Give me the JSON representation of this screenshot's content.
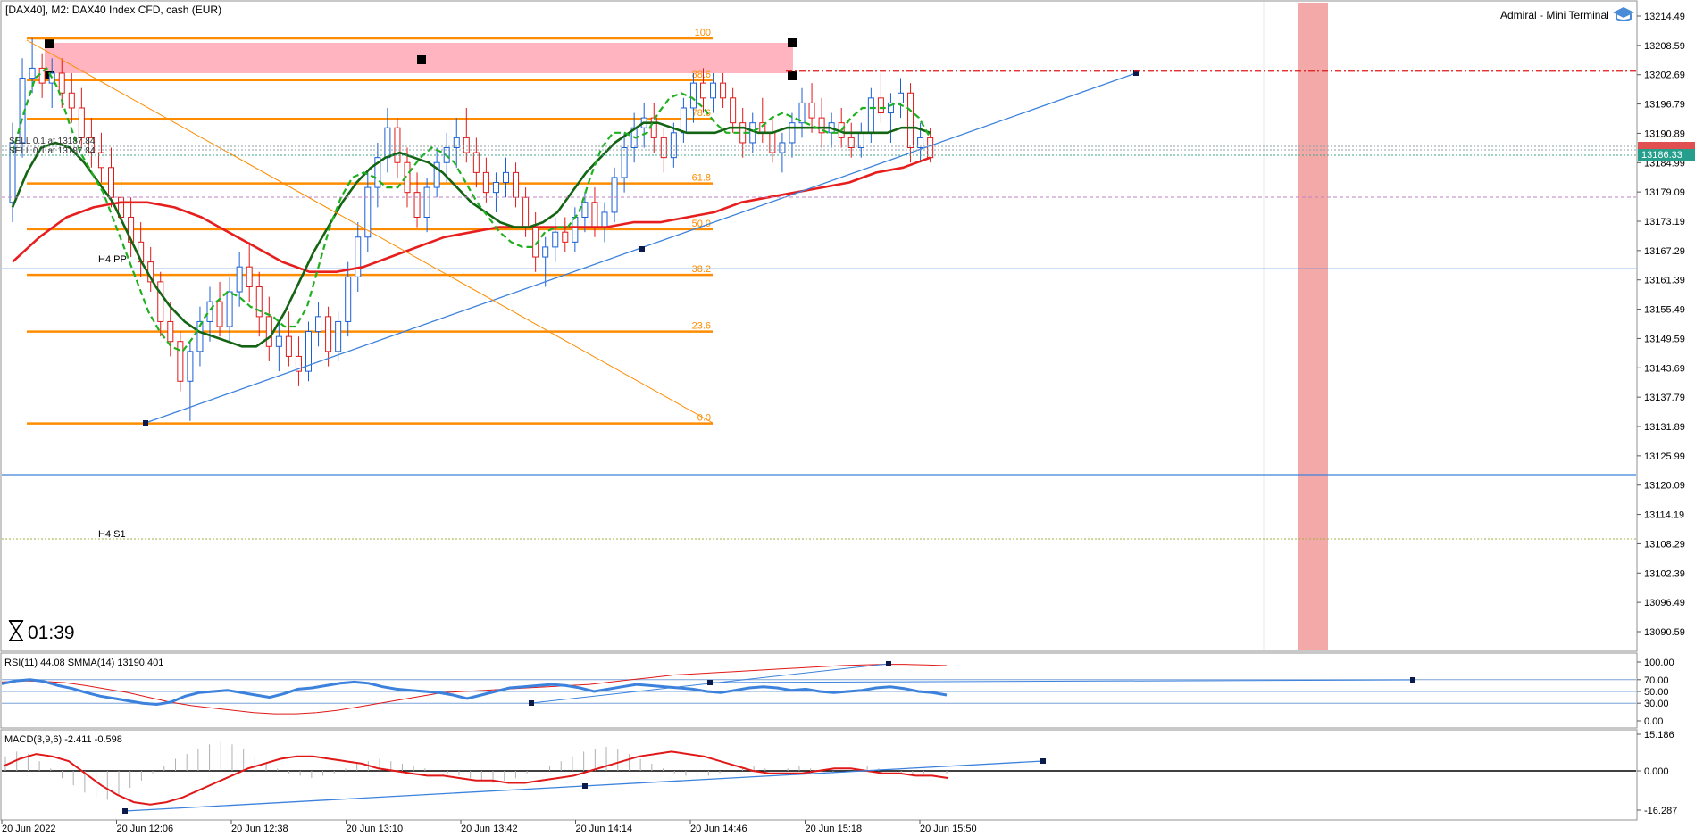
{
  "header": {
    "symbol_title": "[DAX40], M2:  DAX40 Index CFD, cash (EUR)",
    "terminal_label": "Admiral - Mini Terminal"
  },
  "timer": {
    "label": "01:39"
  },
  "colors": {
    "bull": "#1a5fd6",
    "bear": "#e01818",
    "fib": "#ff8c00",
    "trend": "#3c82dc",
    "ma_fast": "#1fb01f",
    "ma_mid": "#136413",
    "ma_slow": "#e61e1e",
    "zone": "#ffb4bf",
    "band": "#f08c8c",
    "price_tag": "#259e8c"
  },
  "order_labels": [
    "SELL 0.1 at 13187.84",
    "SELL 0.1 at 13187.84"
  ],
  "pivot_labels": {
    "pp": "H4 PP",
    "s1": "H4 S1"
  },
  "current_price": "13186.33",
  "chart_data": [
    {
      "type": "candlestick",
      "y_ticks": [
        "13214.49",
        "13208.59",
        "13202.69",
        "13196.79",
        "13190.89",
        "13184.99",
        "13179.09",
        "13173.19",
        "13167.29",
        "13161.39",
        "13155.49",
        "13149.59",
        "13143.69",
        "13137.79",
        "13131.89",
        "13125.99",
        "13120.09",
        "13114.19",
        "13108.29",
        "13102.39",
        "13096.49",
        "13090.59"
      ],
      "ylim": [
        13085.5,
        13216.8
      ],
      "x_ticks": [
        "20 Jun 2022",
        "20 Jun 12:06",
        "20 Jun 12:38",
        "20 Jun 13:10",
        "20 Jun 13:42",
        "20 Jun 14:14",
        "20 Jun 14:46",
        "20 Jun 15:18",
        "20 Jun 15:50"
      ],
      "fib_levels": [
        {
          "label": "100",
          "value": 13210.0
        },
        {
          "label": "88.6",
          "value": 13201.6
        },
        {
          "label": "78.6",
          "value": 13193.8
        },
        {
          "label": "61.8",
          "value": 13180.8
        },
        {
          "label": "50.0",
          "value": 13171.6
        },
        {
          "label": "38.2",
          "value": 13162.4
        },
        {
          "label": "23.6",
          "value": 13151.0
        },
        {
          "label": "0.0",
          "value": 13132.5
        }
      ],
      "horizontal_lines": [
        13163.6,
        13122.2
      ],
      "red_dashdot_level": 13203.4,
      "candles": [
        {
          "o": 13177,
          "h": 13193,
          "l": 13173,
          "c": 13189
        },
        {
          "o": 13189,
          "h": 13206,
          "l": 13186,
          "c": 13202
        },
        {
          "o": 13202,
          "h": 13210,
          "l": 13199,
          "c": 13204
        },
        {
          "o": 13204,
          "h": 13207,
          "l": 13198,
          "c": 13201
        },
        {
          "o": 13201,
          "h": 13206,
          "l": 13196,
          "c": 13203
        },
        {
          "o": 13203,
          "h": 13206,
          "l": 13196,
          "c": 13199
        },
        {
          "o": 13199,
          "h": 13203,
          "l": 13193,
          "c": 13196
        },
        {
          "o": 13196,
          "h": 13200,
          "l": 13188,
          "c": 13190
        },
        {
          "o": 13190,
          "h": 13194,
          "l": 13184,
          "c": 13187
        },
        {
          "o": 13187,
          "h": 13191,
          "l": 13181,
          "c": 13184
        },
        {
          "o": 13184,
          "h": 13188,
          "l": 13176,
          "c": 13178
        },
        {
          "o": 13178,
          "h": 13182,
          "l": 13172,
          "c": 13174
        },
        {
          "o": 13174,
          "h": 13178,
          "l": 13166,
          "c": 13169
        },
        {
          "o": 13169,
          "h": 13173,
          "l": 13162,
          "c": 13165
        },
        {
          "o": 13165,
          "h": 13168,
          "l": 13159,
          "c": 13161
        },
        {
          "o": 13161,
          "h": 13163,
          "l": 13150,
          "c": 13153
        },
        {
          "o": 13153,
          "h": 13157,
          "l": 13146,
          "c": 13149
        },
        {
          "o": 13149,
          "h": 13151,
          "l": 13139,
          "c": 13141
        },
        {
          "o": 13141,
          "h": 13149,
          "l": 13133,
          "c": 13147
        },
        {
          "o": 13147,
          "h": 13156,
          "l": 13144,
          "c": 13153
        },
        {
          "o": 13153,
          "h": 13160,
          "l": 13149,
          "c": 13157
        },
        {
          "o": 13157,
          "h": 13161,
          "l": 13150,
          "c": 13152
        },
        {
          "o": 13152,
          "h": 13162,
          "l": 13149,
          "c": 13159
        },
        {
          "o": 13159,
          "h": 13167,
          "l": 13156,
          "c": 13164
        },
        {
          "o": 13164,
          "h": 13169,
          "l": 13157,
          "c": 13160
        },
        {
          "o": 13160,
          "h": 13163,
          "l": 13150,
          "c": 13154
        },
        {
          "o": 13154,
          "h": 13158,
          "l": 13145,
          "c": 13148
        },
        {
          "o": 13148,
          "h": 13153,
          "l": 13143,
          "c": 13150
        },
        {
          "o": 13150,
          "h": 13155,
          "l": 13144,
          "c": 13146
        },
        {
          "o": 13146,
          "h": 13150,
          "l": 13140,
          "c": 13143
        },
        {
          "o": 13143,
          "h": 13153,
          "l": 13141,
          "c": 13151
        },
        {
          "o": 13151,
          "h": 13157,
          "l": 13148,
          "c": 13154
        },
        {
          "o": 13154,
          "h": 13156,
          "l": 13144,
          "c": 13147
        },
        {
          "o": 13147,
          "h": 13155,
          "l": 13145,
          "c": 13153
        },
        {
          "o": 13153,
          "h": 13165,
          "l": 13150,
          "c": 13162
        },
        {
          "o": 13162,
          "h": 13173,
          "l": 13159,
          "c": 13170
        },
        {
          "o": 13170,
          "h": 13183,
          "l": 13167,
          "c": 13180
        },
        {
          "o": 13180,
          "h": 13189,
          "l": 13176,
          "c": 13186
        },
        {
          "o": 13186,
          "h": 13196,
          "l": 13183,
          "c": 13192
        },
        {
          "o": 13192,
          "h": 13194,
          "l": 13182,
          "c": 13185
        },
        {
          "o": 13185,
          "h": 13188,
          "l": 13176,
          "c": 13179
        },
        {
          "o": 13179,
          "h": 13183,
          "l": 13172,
          "c": 13174
        },
        {
          "o": 13174,
          "h": 13182,
          "l": 13171,
          "c": 13180
        },
        {
          "o": 13180,
          "h": 13188,
          "l": 13178,
          "c": 13185
        },
        {
          "o": 13185,
          "h": 13191,
          "l": 13181,
          "c": 13188
        },
        {
          "o": 13188,
          "h": 13194,
          "l": 13184,
          "c": 13190
        },
        {
          "o": 13190,
          "h": 13196,
          "l": 13185,
          "c": 13187
        },
        {
          "o": 13187,
          "h": 13190,
          "l": 13180,
          "c": 13183
        },
        {
          "o": 13183,
          "h": 13186,
          "l": 13177,
          "c": 13179
        },
        {
          "o": 13179,
          "h": 13183,
          "l": 13175,
          "c": 13181
        },
        {
          "o": 13181,
          "h": 13186,
          "l": 13178,
          "c": 13183
        },
        {
          "o": 13183,
          "h": 13185,
          "l": 13176,
          "c": 13178
        },
        {
          "o": 13178,
          "h": 13180,
          "l": 13170,
          "c": 13172
        },
        {
          "o": 13172,
          "h": 13175,
          "l": 13163,
          "c": 13166
        },
        {
          "o": 13166,
          "h": 13170,
          "l": 13160,
          "c": 13168
        },
        {
          "o": 13168,
          "h": 13174,
          "l": 13165,
          "c": 13171
        },
        {
          "o": 13171,
          "h": 13174,
          "l": 13167,
          "c": 13169
        },
        {
          "o": 13169,
          "h": 13176,
          "l": 13167,
          "c": 13174
        },
        {
          "o": 13174,
          "h": 13179,
          "l": 13171,
          "c": 13177
        },
        {
          "o": 13177,
          "h": 13180,
          "l": 13170,
          "c": 13172
        },
        {
          "o": 13172,
          "h": 13177,
          "l": 13169,
          "c": 13175
        },
        {
          "o": 13175,
          "h": 13184,
          "l": 13173,
          "c": 13182
        },
        {
          "o": 13182,
          "h": 13191,
          "l": 13179,
          "c": 13188
        },
        {
          "o": 13188,
          "h": 13195,
          "l": 13185,
          "c": 13192
        },
        {
          "o": 13192,
          "h": 13197,
          "l": 13188,
          "c": 13194
        },
        {
          "o": 13194,
          "h": 13197,
          "l": 13187,
          "c": 13190
        },
        {
          "o": 13190,
          "h": 13192,
          "l": 13183,
          "c": 13186
        },
        {
          "o": 13186,
          "h": 13193,
          "l": 13184,
          "c": 13191
        },
        {
          "o": 13191,
          "h": 13198,
          "l": 13189,
          "c": 13196
        },
        {
          "o": 13196,
          "h": 13203,
          "l": 13193,
          "c": 13201
        },
        {
          "o": 13201,
          "h": 13204,
          "l": 13195,
          "c": 13198
        },
        {
          "o": 13198,
          "h": 13203,
          "l": 13195,
          "c": 13201
        },
        {
          "o": 13201,
          "h": 13203,
          "l": 13196,
          "c": 13198
        },
        {
          "o": 13198,
          "h": 13200,
          "l": 13191,
          "c": 13193
        },
        {
          "o": 13193,
          "h": 13196,
          "l": 13186,
          "c": 13189
        },
        {
          "o": 13189,
          "h": 13195,
          "l": 13187,
          "c": 13193
        },
        {
          "o": 13193,
          "h": 13198,
          "l": 13189,
          "c": 13191
        },
        {
          "o": 13191,
          "h": 13194,
          "l": 13185,
          "c": 13187
        },
        {
          "o": 13187,
          "h": 13191,
          "l": 13183,
          "c": 13189
        },
        {
          "o": 13189,
          "h": 13195,
          "l": 13186,
          "c": 13193
        },
        {
          "o": 13193,
          "h": 13200,
          "l": 13190,
          "c": 13197
        },
        {
          "o": 13197,
          "h": 13201,
          "l": 13191,
          "c": 13194
        },
        {
          "o": 13194,
          "h": 13198,
          "l": 13188,
          "c": 13191
        },
        {
          "o": 13191,
          "h": 13195,
          "l": 13188,
          "c": 13193
        },
        {
          "o": 13193,
          "h": 13196,
          "l": 13188,
          "c": 13190
        },
        {
          "o": 13190,
          "h": 13193,
          "l": 13186,
          "c": 13188
        },
        {
          "o": 13188,
          "h": 13193,
          "l": 13186,
          "c": 13191
        },
        {
          "o": 13191,
          "h": 13200,
          "l": 13189,
          "c": 13198
        },
        {
          "o": 13198,
          "h": 13203,
          "l": 13193,
          "c": 13195
        },
        {
          "o": 13195,
          "h": 13199,
          "l": 13189,
          "c": 13197
        },
        {
          "o": 13197,
          "h": 13202,
          "l": 13194,
          "c": 13199
        },
        {
          "o": 13199,
          "h": 13201,
          "l": 13185,
          "c": 13188
        },
        {
          "o": 13188,
          "h": 13193,
          "l": 13185,
          "c": 13190
        },
        {
          "o": 13190,
          "h": 13192,
          "l": 13185,
          "c": 13186
        }
      ],
      "ma_fast": [
        13187,
        13195,
        13202,
        13204,
        13200,
        13193,
        13187,
        13183,
        13179,
        13173,
        13167,
        13161,
        13155,
        13151,
        13148,
        13147,
        13150,
        13154,
        13157,
        13159,
        13158,
        13156,
        13155,
        13154,
        13152,
        13152,
        13156,
        13164,
        13172,
        13178,
        13182,
        13183,
        13182,
        13180,
        13180,
        13183,
        13186,
        13188,
        13187,
        13185,
        13181,
        13177,
        13174,
        13171,
        13169,
        13168,
        13168,
        13171,
        13172,
        13172,
        13175,
        13182,
        13188,
        13191,
        13191,
        13190,
        13191,
        13195,
        13198,
        13199,
        13198,
        13196,
        13193,
        13191,
        13191,
        13191,
        13192,
        13194,
        13195,
        13194,
        13193,
        13192,
        13191,
        13191,
        13194,
        13196,
        13196,
        13196,
        13197,
        13196,
        13194,
        13190
      ],
      "ma_mid": [
        13176,
        13183,
        13188,
        13189,
        13188,
        13185,
        13181,
        13177,
        13171,
        13165,
        13160,
        13156,
        13153,
        13151,
        13150,
        13149,
        13148,
        13148,
        13150,
        13155,
        13161,
        13167,
        13172,
        13177,
        13181,
        13184,
        13186,
        13187,
        13186,
        13185,
        13183,
        13180,
        13177,
        13175,
        13173,
        13172,
        13172,
        13173,
        13175,
        13179,
        13183,
        13186,
        13189,
        13191,
        13193,
        13193,
        13192,
        13191,
        13191,
        13191,
        13192,
        13192,
        13191,
        13191,
        13192,
        13192,
        13192,
        13192,
        13191,
        13191,
        13191,
        13191,
        13192,
        13192,
        13191
      ],
      "ma_slow": [
        13165,
        13170,
        13174,
        13176,
        13177,
        13177,
        13176,
        13174,
        13171,
        13168,
        13165,
        13163,
        13163,
        13164,
        13166,
        13168,
        13170,
        13171,
        13172,
        13172,
        13172,
        13172,
        13172,
        13173,
        13173,
        13174,
        13175,
        13177,
        13178,
        13179,
        13180,
        13181,
        13183,
        13184,
        13186
      ]
    },
    {
      "type": "line",
      "label": "RSI(11) 44.08 SMMA(14) 13190.401",
      "y_ticks": [
        "100.00",
        "70.00",
        "50.00",
        "30.00",
        "0.00"
      ],
      "ylim": [
        0,
        100
      ],
      "levels": [
        70,
        50,
        30
      ],
      "rsi": [
        63,
        68,
        70,
        67,
        60,
        55,
        48,
        42,
        38,
        34,
        30,
        28,
        32,
        42,
        48,
        50,
        52,
        48,
        44,
        40,
        46,
        54,
        56,
        60,
        64,
        66,
        64,
        58,
        54,
        52,
        50,
        48,
        44,
        38,
        44,
        50,
        56,
        58,
        60,
        62,
        60,
        56,
        50,
        54,
        58,
        62,
        60,
        58,
        56,
        54,
        50,
        48,
        52,
        56,
        58,
        56,
        52,
        54,
        50,
        48,
        50,
        52,
        56,
        58,
        55,
        50,
        48,
        44
      ],
      "smma": [
        66,
        68,
        67,
        65,
        60,
        54,
        48,
        40,
        32,
        26,
        22,
        18,
        14,
        12,
        12,
        14,
        18,
        24,
        30,
        36,
        42,
        48,
        50,
        52,
        54,
        56,
        58,
        60,
        62,
        66,
        70,
        74,
        78,
        80,
        82,
        84,
        86,
        88,
        90,
        92,
        94,
        95,
        96,
        96,
        95,
        94
      ]
    },
    {
      "type": "bar",
      "label": "MACD(3,9,6) -2.411 -0.598",
      "y_ticks": [
        "15.186",
        "0.000",
        "-16.287"
      ],
      "ylim": [
        -16.287,
        15.186
      ],
      "histogram": [
        6,
        8,
        7,
        4,
        1,
        -3,
        -6,
        -9,
        -11,
        -12,
        -10,
        -7,
        -4,
        -1,
        2,
        5,
        7,
        9,
        11,
        12,
        11,
        9,
        6,
        3,
        1,
        -1,
        -2,
        -3,
        -2,
        -1,
        1,
        3,
        4,
        5,
        4,
        3,
        2,
        1,
        0,
        -1,
        -2,
        -3,
        -4,
        -5,
        -4,
        -3,
        -1,
        0,
        2,
        4,
        6,
        8,
        9,
        10,
        9,
        7,
        5,
        3,
        1,
        -1,
        -2,
        -3,
        -2,
        -1,
        0,
        1,
        2,
        1,
        0,
        1,
        2,
        1,
        0,
        -1,
        0,
        1,
        2,
        1,
        0,
        -1,
        -2,
        -1,
        0,
        -1
      ],
      "signal": [
        2,
        5,
        7,
        6,
        4,
        -1,
        -6,
        -10,
        -13,
        -14,
        -13,
        -11,
        -8,
        -5,
        -2,
        1,
        3,
        5,
        6,
        6,
        5,
        4,
        3,
        1,
        0,
        -1,
        -2,
        -2,
        -3,
        -4,
        -4,
        -5,
        -5,
        -4,
        -3,
        -2,
        0,
        2,
        4,
        6,
        7,
        8,
        7,
        6,
        4,
        2,
        0,
        -1,
        -1,
        -1,
        0,
        1,
        1,
        0,
        -1,
        -1,
        -2,
        -2,
        -3
      ]
    }
  ]
}
